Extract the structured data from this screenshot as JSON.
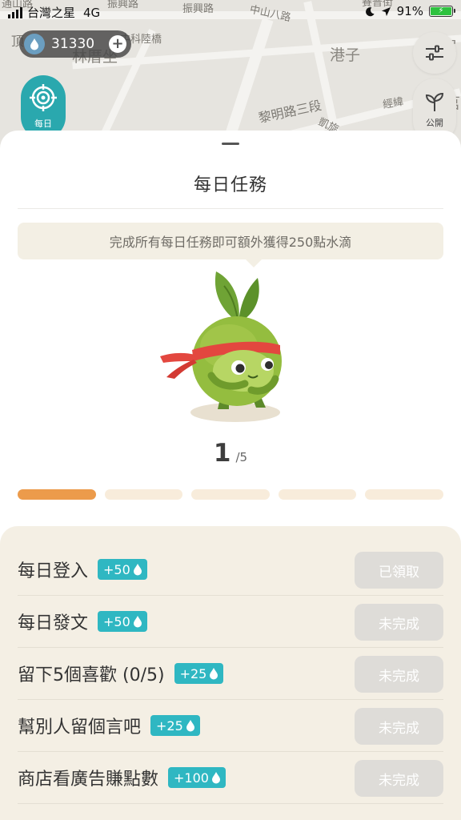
{
  "status_bar": {
    "carrier": "台灣之星",
    "network": "4G",
    "battery": "91%"
  },
  "map": {
    "labels": [
      "通山路",
      "振興路",
      "振興路",
      "中山八路",
      "賽普街",
      "頂",
      "中科陸橋",
      "林厝坐",
      "港子",
      "尾",
      "經緯",
      "黎明路三段",
      "凱旋",
      "莒"
    ]
  },
  "points": {
    "value": "31330",
    "icon": "water-drop-icon",
    "add_icon": "plus-icon"
  },
  "locate_button": {
    "label": "每日",
    "icon": "target-icon"
  },
  "filter_button": {
    "icon": "sliders-icon"
  },
  "public_button": {
    "label": "公開",
    "icon": "sprout-icon"
  },
  "sheet": {
    "title": "每日任務",
    "bubble_text": "完成所有每日任務即可額外獲得250點水滴",
    "progress": {
      "current": "1",
      "total": "/5",
      "done_count": 1,
      "segments": 5
    }
  },
  "tasks": [
    {
      "name": "每日登入",
      "reward": "+50",
      "button": "已領取"
    },
    {
      "name": "每日發文",
      "reward": "+50",
      "button": "未完成"
    },
    {
      "name": "留下5個喜歡 (0/5)",
      "reward": "+25",
      "button": "未完成"
    },
    {
      "name": "幫別人留個言吧",
      "reward": "+25",
      "button": "未完成"
    },
    {
      "name": "商店看廣告賺點數",
      "reward": "+100",
      "button": "未完成"
    }
  ],
  "colors": {
    "teal": "#2fb7c2",
    "orange": "#ec9b4b",
    "panel": "#f4efe4",
    "button_disabled": "#dedcd8"
  }
}
